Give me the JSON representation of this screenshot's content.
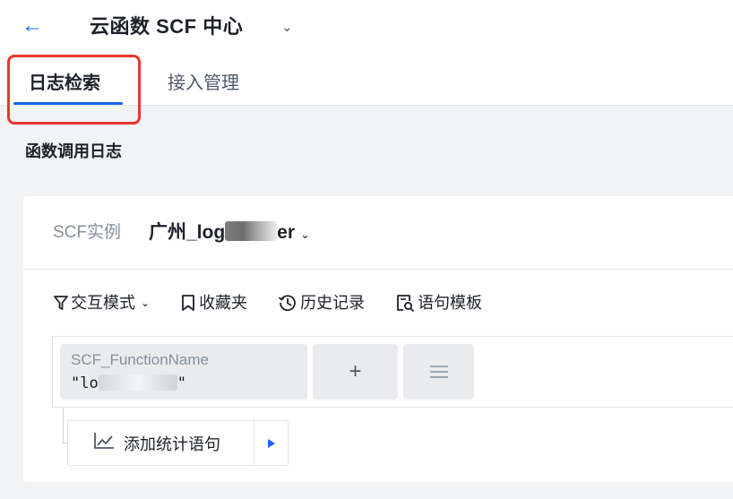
{
  "header": {
    "back_icon": "arrow-left-icon",
    "title": "云函数 SCF 中心",
    "title_dropdown_icon": "chevron-down-icon"
  },
  "tabs": [
    {
      "label": "日志检索",
      "active": true
    },
    {
      "label": "接入管理",
      "active": false
    }
  ],
  "section": {
    "title": "函数调用日志"
  },
  "instance": {
    "label": "SCF实例",
    "value_prefix": "广州_log",
    "value_suffix": "er",
    "redacted": true
  },
  "toolbar": {
    "interactive_mode": "交互模式",
    "favorites": "收藏夹",
    "history": "历史记录",
    "templates": "语句模板"
  },
  "query": {
    "chip": {
      "key": "SCF_FunctionName",
      "value_prefix": "\"lo",
      "value_suffix": "\"",
      "redacted": true
    },
    "add_label": "+",
    "list_icon": "list-icon"
  },
  "stat": {
    "label": "添加统计语句",
    "icon": "line-chart-icon",
    "arrow_icon": "triangle-right-icon"
  },
  "colors": {
    "accent": "#1664ff",
    "highlight": "#e8362f",
    "background": "#f2f3f5",
    "chip_bg": "#e9ebef"
  }
}
